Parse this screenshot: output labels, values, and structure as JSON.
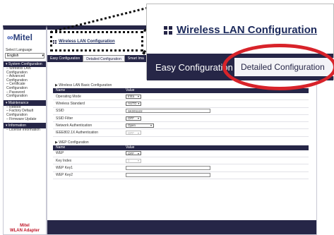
{
  "sidebar": {
    "logo_text": "Mitel",
    "language_label": "Select Language",
    "language_value": "English",
    "sections": [
      {
        "title": "System Configuration",
        "items": [
          "Wireless LAN Configuration",
          "Advanced Configuration",
          "Certificate Configuration",
          "Password Configuration"
        ]
      },
      {
        "title": "Maintenance",
        "items": [
          "Reboot",
          "Factory Default Configuration",
          "Firmware Update"
        ]
      },
      {
        "title": "Information",
        "items": [
          "License Information"
        ]
      }
    ],
    "footer_line1": "Mitel",
    "footer_line2": "WLAN Adapter"
  },
  "main": {
    "page_title": "Wireless LAN Configuration",
    "tabs": [
      "Easy Configuration",
      "Detailed Configuration",
      "Smart Ima"
    ]
  },
  "basic": {
    "title": "Wireless LAN Basic Configuration",
    "col_name": "Name",
    "col_value": "Value",
    "rows": [
      {
        "label": "Operating Mode",
        "value": "Infra",
        "kind": "select"
      },
      {
        "label": "Wireless Standard",
        "value": "AUTO",
        "kind": "select"
      },
      {
        "label": "SSID",
        "value": "SK001122",
        "kind": "input"
      },
      {
        "label": "SSID Filter",
        "value": "OFF",
        "kind": "select"
      },
      {
        "label": "Network Authentication",
        "value": "Open",
        "kind": "select-wide"
      },
      {
        "label": "IEEE802.1X Authentication",
        "value": "OFF",
        "kind": "select-disabled"
      }
    ]
  },
  "wep": {
    "title": "WEP Configuration",
    "col_name": "Name",
    "col_value": "Value",
    "rows": [
      {
        "label": "WEP",
        "value": "OFF",
        "kind": "select"
      },
      {
        "label": "Key Index",
        "value": "1",
        "kind": "select-disabled"
      },
      {
        "label": "WEP Key1",
        "value": "",
        "kind": "input"
      },
      {
        "label": "WEP Key2",
        "value": "",
        "kind": "input"
      }
    ]
  },
  "zoom": {
    "page_title": "Wireless LAN Configuration",
    "tab_easy": "Easy Configuration",
    "tab_detailed": "Detailed Configuration"
  },
  "colors": {
    "navy": "#262647",
    "highlight_red": "#d8232a",
    "brand_blue": "#2b4aa8"
  }
}
